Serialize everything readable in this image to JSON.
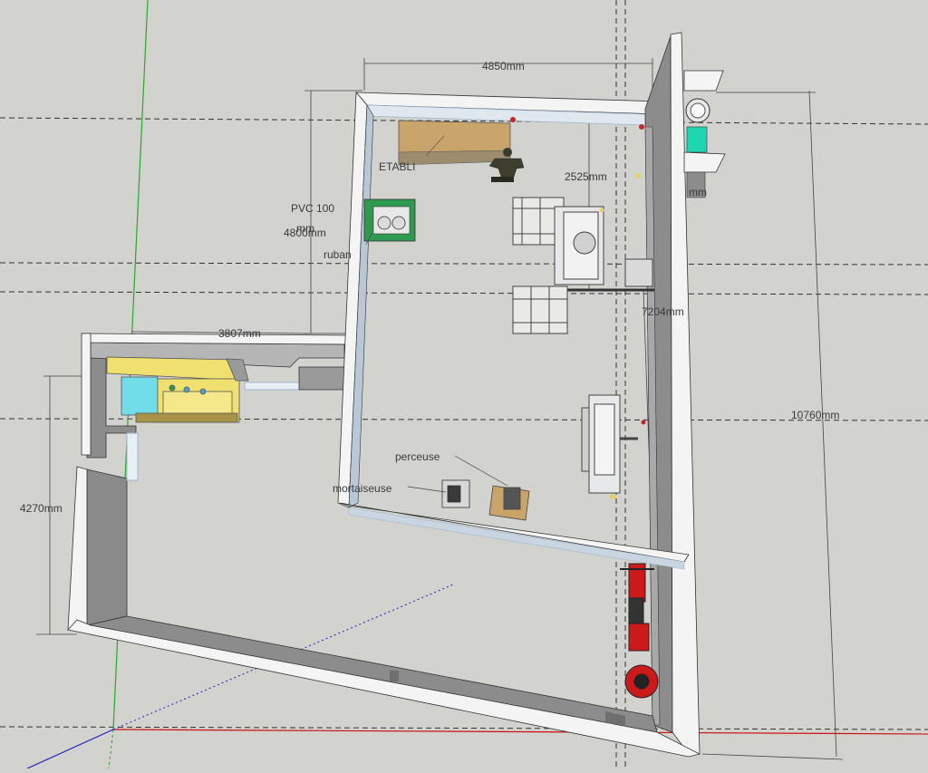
{
  "dimensions": {
    "top_width": "4850mm",
    "depth_2525": "2525mm",
    "left_depth": "4800mm",
    "annex_width": "3807mm",
    "machine_spacing": "7204mm",
    "total_length": "10760mm",
    "annex_depth": "4270mm",
    "partial_mm": "mm"
  },
  "labels": {
    "etabli": "ETABLI",
    "pvc_line1": "PVC 100",
    "pvc_line2": "mm",
    "ruban": "ruban",
    "perceuse": "perceuse",
    "mortaiseuse": "mortaiseuse"
  },
  "colors": {
    "background": "#d2d2cf",
    "wall_top": "#f4f4f4",
    "wall_side": "#8c8c8c",
    "wall_edge": "#9fb6cc",
    "axis_green": "#2aa82a",
    "axis_red": "#cc1111",
    "axis_blue": "#2222bb",
    "workbench": "#c8a46a",
    "cabinet_yellow": "#f0e070",
    "cabinet_cyan": "#70dde8",
    "bandsaw_green": "#2e9a50",
    "motorcycle_red": "#cc1a1a"
  }
}
